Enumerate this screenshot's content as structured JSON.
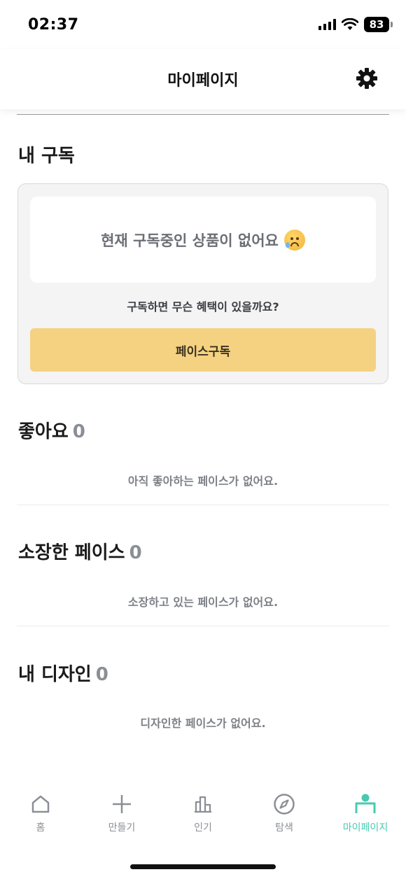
{
  "status_bar": {
    "time": "02:37",
    "battery": "83",
    "icons": [
      "signal-icon",
      "wifi-icon",
      "battery-icon"
    ]
  },
  "header": {
    "title": "마이페이지",
    "settings_icon": "gear-icon"
  },
  "subscription": {
    "section_title": "내 구독",
    "empty_text": "현재 구독중인 상품이 없어요",
    "emoji": "sad-tear-emoji",
    "benefit_question": "구독하면 무슨 혜택이 있을까요?",
    "button_label": "페이스구독",
    "button_color": "#f5d281"
  },
  "likes": {
    "title": "좋아요",
    "count": "0",
    "empty": "아직 좋아하는 페이스가 없어요."
  },
  "owned": {
    "title": "소장한 페이스",
    "count": "0",
    "empty": "소장하고 있는 페이스가 없어요."
  },
  "designs": {
    "title": "내 디자인",
    "count": "0",
    "empty": "디자인한 페이스가 없어요."
  },
  "tab_bar": {
    "active_color": "#48c9b0",
    "items": [
      {
        "label": "홈",
        "icon": "home-icon"
      },
      {
        "label": "만들기",
        "icon": "plus-icon"
      },
      {
        "label": "인기",
        "icon": "chart-icon"
      },
      {
        "label": "탐색",
        "icon": "compass-icon"
      },
      {
        "label": "마이페이지",
        "icon": "profile-icon",
        "active": true
      }
    ]
  }
}
